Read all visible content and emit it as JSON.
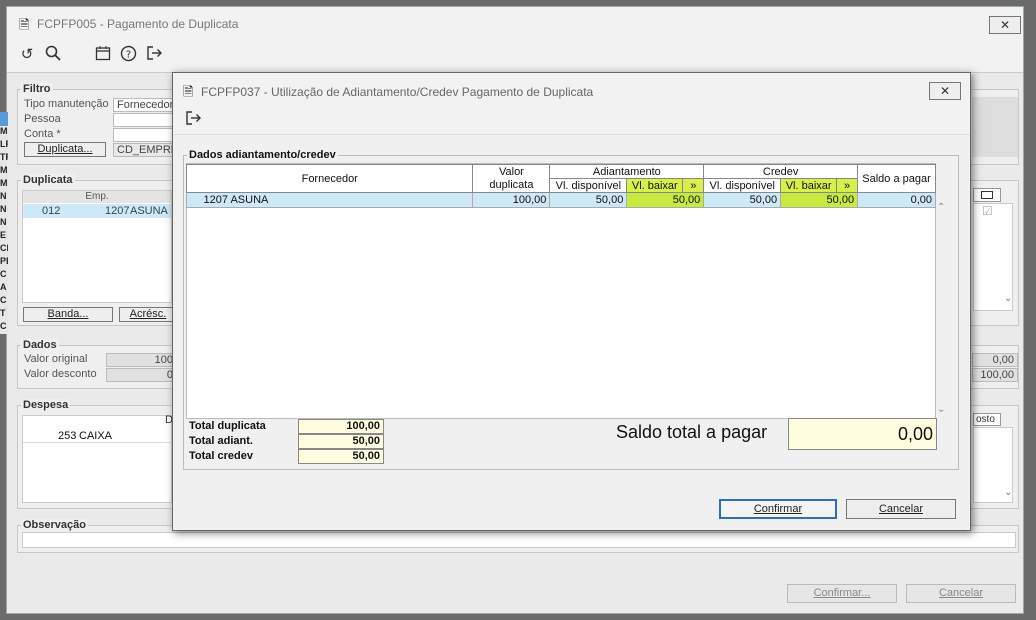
{
  "background_window": {
    "title": "FCPFP005 - Pagamento de Duplicata",
    "close_label": "✕",
    "toolbar": [
      "undo-icon",
      "search-icon",
      "calendar-icon",
      "help-icon",
      "exit-icon"
    ],
    "filtro": {
      "legend": "Filtro",
      "tipo_label": "Tipo manutenção",
      "tipo_value": "Fornecedor",
      "pessoa_label": "Pessoa",
      "conta_label": "Conta *",
      "duplicata_button": "Duplicata...",
      "cd_empresa": "CD_EMPRES"
    },
    "duplicata": {
      "legend": "Duplicata",
      "col_emp": "Emp.",
      "row": {
        "emp": "012",
        "num": "1207",
        "name": "ASUNA"
      },
      "banda_button": "Banda...",
      "acresc_button": "Acrésc."
    },
    "dados": {
      "legend": "Dados",
      "valor_original_label": "Valor original",
      "valor_original_value": "100",
      "valor_desconto_label": "Valor desconto",
      "valor_desconto_value": "0",
      "right_value_1": "0,00",
      "right_value_2": "100,00"
    },
    "despesa": {
      "legend": "Despesa",
      "col_d": "D",
      "col_osto": "osto",
      "row": {
        "num": "253",
        "name": "CAIXA"
      }
    },
    "observacao": {
      "legend": "Observação"
    },
    "confirm_button": "Confirmar...",
    "cancel_button": "Cancelar",
    "left_edge_letters": [
      "M",
      "LF",
      "TF",
      "M",
      "M",
      "N",
      "N",
      "N",
      "E",
      "CI",
      "PE",
      "C",
      "A",
      "C",
      "T",
      "C"
    ]
  },
  "modal": {
    "title": "FCPFP037 - Utilização de Adiantamento/Credev Pagamento de Duplicata",
    "close_label": "✕",
    "exit_icon": "exit-icon",
    "group_legend": "Dados adiantamento/credev",
    "table": {
      "headers": {
        "fornecedor": "Fornecedor",
        "valor_duplicata": "Valor duplicata",
        "adiantamento": "Adiantamento",
        "credev": "Credev",
        "saldo": "Saldo a pagar",
        "vl_disponivel": "Vl. disponível",
        "vl_baixar": "Vl. baixar",
        "arrow": "»"
      },
      "rows": [
        {
          "codigo": "1207",
          "nome": "ASUNA",
          "valor_duplicata": "100,00",
          "adi_disp": "50,00",
          "adi_baixar": "50,00",
          "cre_disp": "50,00",
          "cre_baixar": "50,00",
          "saldo": "0,00"
        }
      ]
    },
    "totals": {
      "duplicata_label": "Total duplicata",
      "duplicata_value": "100,00",
      "adiant_label": "Total adiant.",
      "adiant_value": "50,00",
      "credev_label": "Total credev",
      "credev_value": "50,00"
    },
    "saldo_total_label": "Saldo total a pagar",
    "saldo_total_value": "0,00",
    "confirm_button": "Confirmar",
    "cancel_button": "Cancelar"
  },
  "colors": {
    "highlight_yellow": "#d8f04a",
    "selected_row": "#cde8f7",
    "total_bg": "#fffde0"
  }
}
